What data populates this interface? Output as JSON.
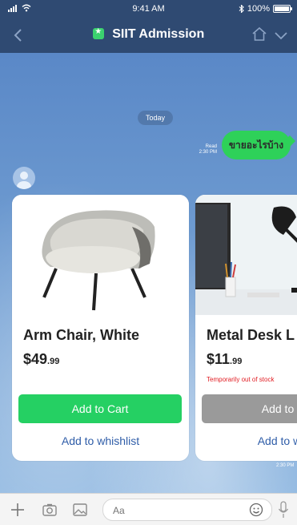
{
  "status_bar": {
    "time": "9:41 AM",
    "battery_text": "100%"
  },
  "header": {
    "title": "SIIT Admission"
  },
  "chat": {
    "date_label": "Today",
    "outgoing_message": {
      "text": "ขายอะไรบ้าง",
      "read_label": "Read",
      "time": "2:30 PM"
    },
    "flex_time": "2:30 PM",
    "products": [
      {
        "name": "Arm Chair, White",
        "price_main": "$49",
        "price_cents": ".99",
        "stock_note": "",
        "cart_label": "Add to Cart",
        "wishlist_label": "Add to whishlist",
        "in_stock": true
      },
      {
        "name": "Metal Desk L",
        "price_main": "$11",
        "price_cents": ".99",
        "stock_note": "Temporarily out of stock",
        "cart_label": "Add to C",
        "wishlist_label": "Add to wis",
        "in_stock": false
      }
    ]
  },
  "composer": {
    "placeholder": "Aa"
  },
  "colors": {
    "header": "#2f4a72",
    "line_green": "#25d063",
    "disabled_button": "#9a9a9a",
    "link_blue": "#2f5da8",
    "alert_red": "#e11d23"
  },
  "icons": [
    "signal-icon",
    "wifi-icon",
    "bluetooth-icon",
    "battery-icon",
    "back-chevron-icon",
    "verified-badge-icon",
    "home-icon",
    "chevron-down-icon",
    "plus-icon",
    "camera-icon",
    "image-icon",
    "emoji-icon",
    "microphone-icon"
  ]
}
